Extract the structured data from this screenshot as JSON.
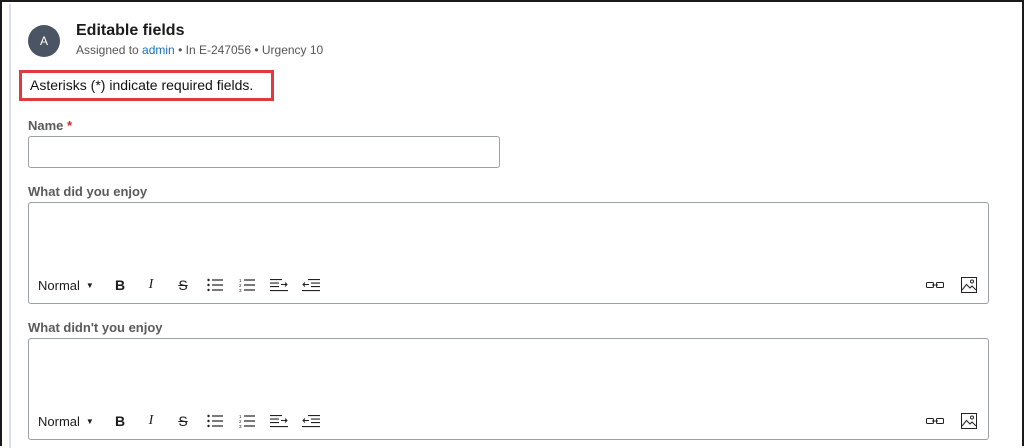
{
  "header": {
    "avatar_initial": "A",
    "title": "Editable fields",
    "subtitle_prefix": "Assigned to ",
    "assignee": "admin",
    "subtitle_suffix": " • In E-247056 • Urgency 10"
  },
  "required_note": "Asterisks (*) indicate required fields.",
  "fields": {
    "name": {
      "label": "Name",
      "required_marker": "*",
      "value": ""
    },
    "enjoy": {
      "label": "What did you enjoy",
      "value": ""
    },
    "not_enjoy": {
      "label": "What didn't you enjoy",
      "value": ""
    }
  },
  "toolbar": {
    "style_label": "Normal",
    "caret": "▼",
    "bold": "B",
    "italic": "I",
    "strike": "S",
    "icons": [
      "bulleted-list-icon",
      "numbered-list-icon",
      "indent-icon",
      "outdent-icon",
      "link-icon",
      "image-icon"
    ]
  },
  "colors": {
    "required_note_border": "#e0393e",
    "link": "#1a6fb5",
    "required_star": "#d0242b",
    "avatar_bg": "#4a5462"
  }
}
